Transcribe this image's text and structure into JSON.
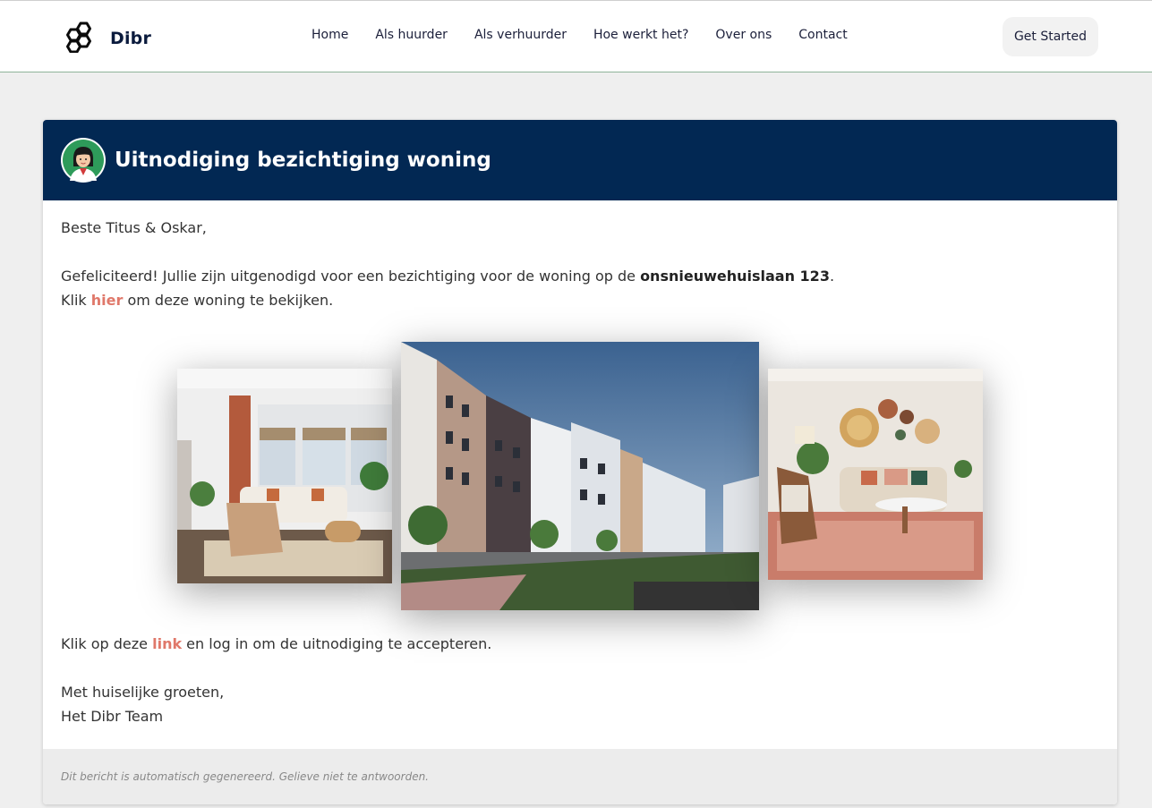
{
  "brand": {
    "name": "Dibr",
    "logo_icon": "hexagon-cluster-icon"
  },
  "nav": {
    "items": [
      "Home",
      "Als huurder",
      "Als verhuurder",
      "Hoe werkt het?",
      "Over ons",
      "Contact"
    ],
    "cta_label": "Get Started"
  },
  "email": {
    "header_title": "Uitnodiging bezichtiging woning",
    "avatar_icon": "agent-avatar-icon",
    "greeting": "Beste Titus & Oskar,",
    "congrats_before": "Gefeliciteerd! Jullie zijn uitgenodigd voor een bezichtiging voor de woning op de ",
    "address": "onsnieuwehuislaan 123",
    "congrats_after": ".",
    "view_prefix": "Klik ",
    "view_link": "hier",
    "view_suffix": " om deze woning te bekijken.",
    "accept_prefix": "Klik op deze ",
    "accept_link": "link",
    "accept_suffix": " en log in om de uitnodiging te accepteren.",
    "signoff": "Met huiselijke groeten,",
    "signature": "Het Dibr Team",
    "footer_note": "Dit bericht is automatisch gegenereerd. Gelieve niet te antwoorden."
  },
  "colors": {
    "header_bg": "#022853",
    "link_accent": "#e0786a",
    "page_bg": "#efefef"
  }
}
